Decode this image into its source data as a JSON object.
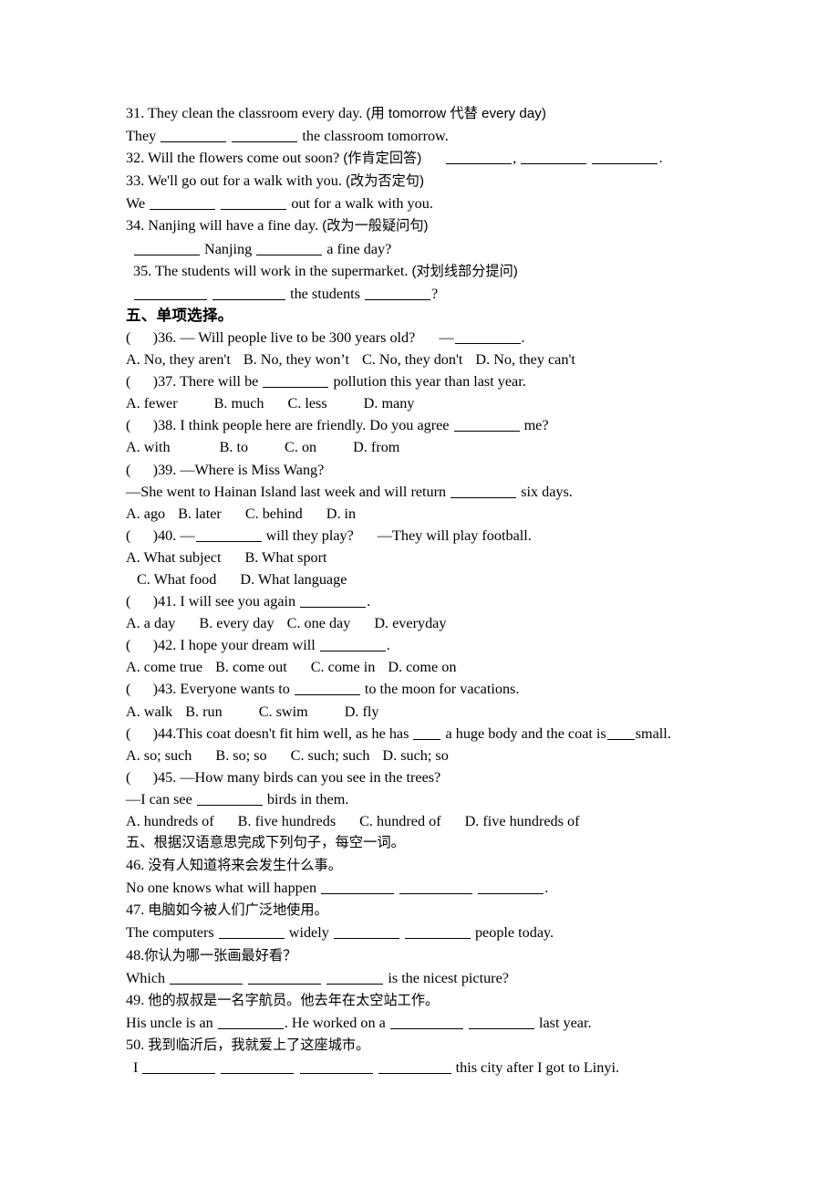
{
  "document": {
    "type": "english-exam-worksheet",
    "language_mix": "English with Chinese instructions"
  },
  "sentence_transform": {
    "items": [
      {
        "number": "31.",
        "prompt": "They clean the classroom every day. (用 tomorrow 代替 every day)",
        "prompt_en": "They clean the classroom every day.",
        "prompt_cn": "(用 tomorrow 代替 every day)",
        "answer_prefix": "They",
        "answer_suffix": "the classroom tomorrow.",
        "blanks": 2
      },
      {
        "number": "32.",
        "prompt_en": "Will the flowers come out soon?",
        "prompt_cn": "(作肯定回答)",
        "blanks": 3
      },
      {
        "number": "33.",
        "prompt_en": "We'll go out for a walk with you.",
        "prompt_cn": "(改为否定句)",
        "answer_prefix": "We",
        "answer_suffix": "out for a walk with you.",
        "blanks": 2
      },
      {
        "number": "34.",
        "prompt_en": "Nanjing will have a fine day.",
        "prompt_cn": "(改为一般疑问句)",
        "answer_mid": "Nanjing",
        "answer_suffix": "a fine day?",
        "blanks": 2
      },
      {
        "number": "35.",
        "prompt_en": "The students will work in the supermarket.",
        "prompt_cn": "(对划线部分提问)",
        "answer_mid": "the students",
        "answer_suffix": "?",
        "blanks": 3
      }
    ]
  },
  "multiple_choice": {
    "heading": "五、单项选择。",
    "bracket": "(      )",
    "items": [
      {
        "number": "36.",
        "stem_pre": "— Will people live to be 300 years old?",
        "stem_post": "—",
        "stem_end": ".",
        "options": [
          "A. No, they aren't",
          "B. No, they won’t",
          "C. No, they don't",
          "D. No, they can't"
        ],
        "option_layout": "single-line"
      },
      {
        "number": "37.",
        "stem_pre": "There will be",
        "stem_post": "pollution this year than last year.",
        "options": [
          "A. fewer",
          "B. much",
          "C. less",
          "D. many"
        ],
        "option_layout": "single-line"
      },
      {
        "number": "38.",
        "stem_pre": "I think people here are friendly. Do you agree",
        "stem_post": "me?",
        "options": [
          "A. with",
          "B. to",
          "C. on",
          "D. from"
        ],
        "option_layout": "single-line"
      },
      {
        "number": "39.",
        "stem_pre": "—Where is Miss Wang?",
        "stem_line2_pre": "—She went to Hainan Island last week and will return",
        "stem_line2_post": "six days.",
        "options": [
          "A. ago",
          "B. later",
          "C. behind",
          "D. in"
        ],
        "option_layout": "single-line"
      },
      {
        "number": "40.",
        "stem_pre": "—",
        "stem_post": "will they play?",
        "stem_end": "—They will play football.",
        "options": [
          "A. What subject",
          "B. What sport",
          "C. What food",
          "D. What language"
        ],
        "option_layout": "two-line"
      },
      {
        "number": "41.",
        "stem_pre": "I will see you again",
        "stem_post": ".",
        "options": [
          "A. a day",
          "B. every day",
          "C. one day",
          "D. everyday"
        ],
        "option_layout": "single-line"
      },
      {
        "number": "42.",
        "stem_pre": "I hope your dream will",
        "stem_post": ".",
        "options": [
          "A. come true",
          "B. come out",
          "C. come in",
          "D. come on"
        ],
        "option_layout": "single-line"
      },
      {
        "number": "43.",
        "stem_pre": "Everyone wants to",
        "stem_post": "to the moon for vacations.",
        "options": [
          "A. walk",
          "B. run",
          "C. swim",
          "D. fly"
        ],
        "option_layout": "single-line"
      },
      {
        "number": "44.",
        "stem_pre": "This coat doesn't fit him well, as he has",
        "stem_mid": "a huge body and the coat is",
        "stem_post": "small.",
        "options": [
          "A. so; such",
          "B. so; so",
          "C. such; such",
          "D. such; so"
        ],
        "option_layout": "single-line"
      },
      {
        "number": "45.",
        "stem_pre": "—How many birds can you see in the trees?",
        "stem_line2_pre": "—I can see",
        "stem_line2_post": "birds in them.",
        "options": [
          "A. hundreds of",
          "B. five hundreds",
          "C. hundred of",
          "D. five hundreds of"
        ],
        "option_layout": "single-line"
      }
    ]
  },
  "translation": {
    "heading": "五、根据汉语意思完成下列句子，每空一词。",
    "items": [
      {
        "number": "46.",
        "chinese": "没有人知道将来会发生什么事。",
        "answer_prefix": "No one knows what will happen",
        "answer_suffix": ".",
        "blanks": 3
      },
      {
        "number": "47.",
        "chinese": "电脑如今被人们广泛地使用。",
        "answer_prefix": "The computers",
        "answer_mid": "widely",
        "answer_suffix": "people today.",
        "blanks": 3
      },
      {
        "number": "48.",
        "chinese": "你认为哪一张画最好看？",
        "answer_prefix": "Which",
        "answer_suffix": "is the nicest picture?",
        "blanks": 3
      },
      {
        "number": "49.",
        "chinese": "他的叔叔是一名字航员。他去年在太空站工作。",
        "answer_prefix": "His uncle is an",
        "answer_mid": ". He worked on a",
        "answer_suffix": "last year.",
        "blanks": 3
      },
      {
        "number": "50.",
        "chinese": "我到临沂后，我就爱上了这座城市。",
        "answer_prefix": "I",
        "answer_suffix": "this city after I got to Linyi.",
        "blanks": 4
      }
    ]
  }
}
